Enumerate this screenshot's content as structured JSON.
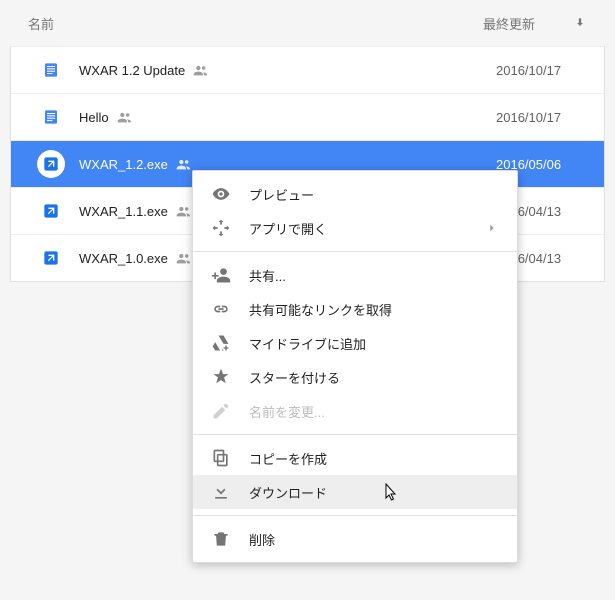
{
  "header": {
    "name_label": "名前",
    "date_label": "最終更新"
  },
  "files": [
    {
      "name": "WXAR 1.2 Update",
      "date": "2016/10/17",
      "type": "doc",
      "shared": true,
      "selected": false
    },
    {
      "name": "Hello",
      "date": "2016/10/17",
      "type": "doc",
      "shared": true,
      "selected": false
    },
    {
      "name": "WXAR_1.2.exe",
      "date": "2016/05/06",
      "type": "exe",
      "shared": true,
      "selected": true
    },
    {
      "name": "WXAR_1.1.exe",
      "date": "2016/04/13",
      "type": "exe",
      "shared": true,
      "selected": false
    },
    {
      "name": "WXAR_1.0.exe",
      "date": "2016/04/13",
      "type": "exe",
      "shared": true,
      "selected": false
    }
  ],
  "menu": {
    "preview": "プレビュー",
    "open_with": "アプリで開く",
    "share": "共有...",
    "get_link": "共有可能なリンクを取得",
    "add_drive": "マイドライブに追加",
    "star": "スターを付ける",
    "rename": "名前を変更...",
    "copy": "コピーを作成",
    "download": "ダウンロード",
    "delete": "削除"
  }
}
